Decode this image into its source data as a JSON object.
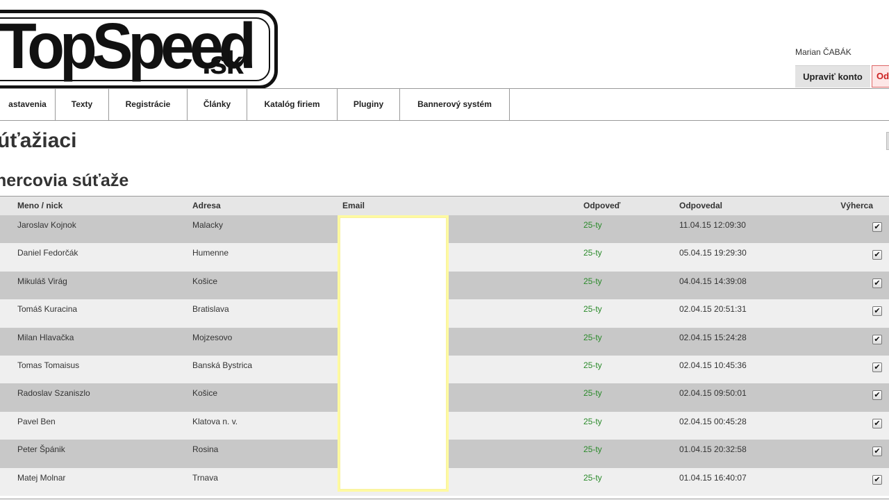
{
  "header": {
    "logo_text": "TopSpeed",
    "logo_tld": ".sk",
    "user_name": "Marian ČABÁK",
    "edit_account": "Upraviť konto",
    "logout": "Od"
  },
  "nav": {
    "items": [
      {
        "label": "astavenia"
      },
      {
        "label": "Texty"
      },
      {
        "label": "Registrácie"
      },
      {
        "label": "Články"
      },
      {
        "label": "Katalóg firiem"
      },
      {
        "label": "Pluginy"
      },
      {
        "label": "Bannerový systém"
      }
    ]
  },
  "page_title": "úťažiaci",
  "section_title": "hercovia súťaže",
  "table": {
    "headers": {
      "name": "Meno / nick",
      "address": "Adresa",
      "email": "Email",
      "answer": "Odpoveď",
      "answered": "Odpovedal",
      "winner": "Výherca"
    },
    "rows": [
      {
        "name": "Jaroslav Kojnok",
        "address": "Malacky",
        "answer": "25-ty",
        "answered": "11.04.15 12:09:30",
        "winner": true
      },
      {
        "name": "Daniel Fedorčák",
        "address": "Humenne",
        "answer": "25-ty",
        "answered": "05.04.15 19:29:30",
        "winner": true
      },
      {
        "name": "Mikuláš Virág",
        "address": "Košice",
        "answer": "25-ty",
        "answered": "04.04.15 14:39:08",
        "winner": true
      },
      {
        "name": "Tomáš Kuracina",
        "address": "Bratislava",
        "answer": "25-ty",
        "answered": "02.04.15 20:51:31",
        "winner": true
      },
      {
        "name": "Milan Hlavačka",
        "address": "Mojzesovo",
        "answer": "25-ty",
        "answered": "02.04.15 15:24:28",
        "winner": true
      },
      {
        "name": "Tomas Tomaisus",
        "address": "Banská Bystrica",
        "answer": "25-ty",
        "answered": "02.04.15 10:45:36",
        "winner": true
      },
      {
        "name": "Radoslav Szaniszlo",
        "address": "Košice",
        "answer": "25-ty",
        "answered": "02.04.15 09:50:01",
        "winner": true
      },
      {
        "name": "Pavel Ben",
        "address": "Klatova n. v.",
        "answer": "25-ty",
        "answered": "02.04.15 00:45:28",
        "winner": true
      },
      {
        "name": "Peter Špánik",
        "address": "Rosina",
        "answer": "25-ty",
        "answered": "01.04.15 20:32:58",
        "winner": true
      },
      {
        "name": "Matej Molnar",
        "address": "Trnava",
        "answer": "25-ty",
        "answered": "01.04.15 16:40:07",
        "winner": true
      }
    ]
  },
  "icons": {
    "checkbox": "checkmark-icon"
  },
  "colors": {
    "answer_text": "#2a8a2a",
    "logout_border": "#dd6666",
    "email_mask_border": "#fffaa0"
  }
}
